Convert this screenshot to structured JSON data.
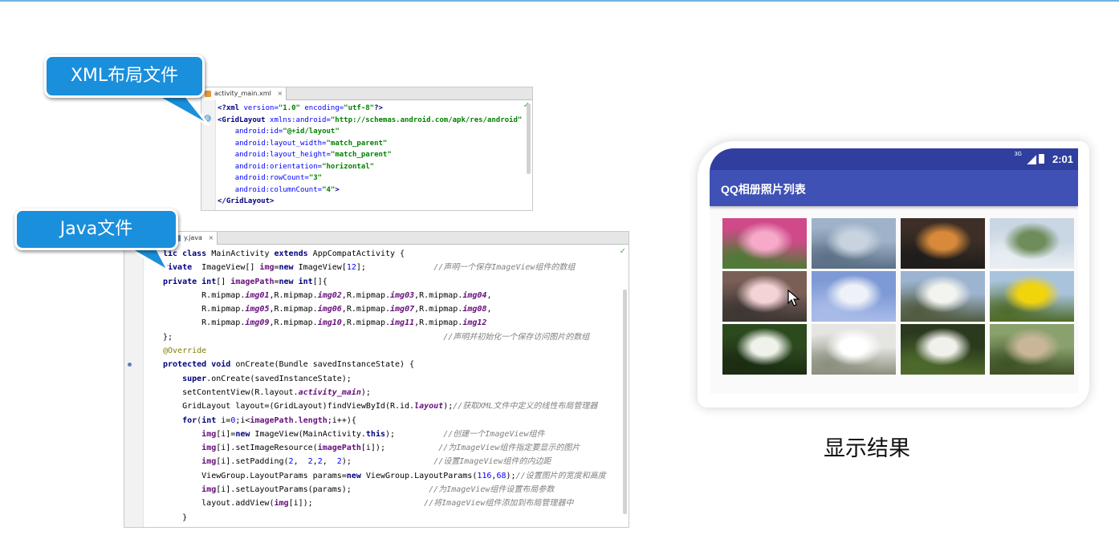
{
  "xml_editor": {
    "tab_label": "activity_main.xml",
    "tab_close": "×",
    "gutter_marker": "c",
    "lines": [
      [
        [
          "xt",
          "<?xml "
        ],
        [
          "xa",
          "version="
        ],
        [
          "xv",
          "\"1.0\" "
        ],
        [
          "xa",
          "encoding="
        ],
        [
          "xv",
          "\"utf-8\""
        ],
        [
          "xt",
          "?>"
        ]
      ],
      [
        [
          "xt",
          "<GridLayout "
        ],
        [
          "xa",
          "xmlns:android="
        ],
        [
          "xv",
          "\"http://schemas.android.com/apk/res/android\""
        ]
      ],
      [
        [
          "",
          "    "
        ],
        [
          "xa",
          "android:id="
        ],
        [
          "xv",
          "\"@+id/layout\""
        ]
      ],
      [
        [
          "",
          "    "
        ],
        [
          "xa",
          "android:layout_width="
        ],
        [
          "xv",
          "\"match_parent\""
        ]
      ],
      [
        [
          "",
          "    "
        ],
        [
          "xa",
          "android:layout_height="
        ],
        [
          "xv",
          "\"match_parent\""
        ]
      ],
      [
        [
          "",
          "    "
        ],
        [
          "xa",
          "android:orientation="
        ],
        [
          "xv",
          "\"horizontal\""
        ]
      ],
      [
        [
          "",
          "    "
        ],
        [
          "xa",
          "android:rowCount="
        ],
        [
          "xv",
          "\"3\""
        ]
      ],
      [
        [
          "",
          "    "
        ],
        [
          "xa",
          "android:columnCount="
        ],
        [
          "xv",
          "\"4\""
        ],
        [
          "xt",
          ">"
        ]
      ],
      [
        [
          "xt",
          "</GridLayout>"
        ]
      ]
    ]
  },
  "java_editor": {
    "tab_label": "y.java",
    "tab_close": "×",
    "lines": [
      [
        [
          "kw",
          "lic class "
        ],
        [
          "",
          "MainActivity "
        ],
        [
          "kw",
          "extends "
        ],
        [
          "",
          "AppCompatActivity {"
        ]
      ],
      [
        [
          "kw",
          "rivate  "
        ],
        [
          "",
          "ImageView[] "
        ],
        [
          "fd",
          "img"
        ],
        [
          "",
          "="
        ],
        [
          "kw",
          "new "
        ],
        [
          "",
          "ImageView["
        ],
        [
          "nm",
          "12"
        ],
        [
          "",
          "];              "
        ],
        [
          "cm",
          "//声明一个保存ImageView组件的数组"
        ]
      ],
      [
        [
          "kw",
          "private int"
        ],
        [
          "",
          "[] "
        ],
        [
          "fd",
          "imagePath"
        ],
        [
          "",
          "="
        ],
        [
          "kw",
          "new int"
        ],
        [
          "",
          "[]{"
        ]
      ],
      [
        [
          "",
          "        R.mipmap."
        ],
        [
          "fdi",
          "img01"
        ],
        [
          "",
          ",R.mipmap."
        ],
        [
          "fdi",
          "img02"
        ],
        [
          "",
          ",R.mipmap."
        ],
        [
          "fdi",
          "img03"
        ],
        [
          "",
          ",R.mipmap."
        ],
        [
          "fdi",
          "img04"
        ],
        [
          "",
          ","
        ]
      ],
      [
        [
          "",
          "        R.mipmap."
        ],
        [
          "fdi",
          "img05"
        ],
        [
          "",
          ",R.mipmap."
        ],
        [
          "fdi",
          "img06"
        ],
        [
          "",
          ",R.mipmap."
        ],
        [
          "fdi",
          "img07"
        ],
        [
          "",
          ",R.mipmap."
        ],
        [
          "fdi",
          "img08"
        ],
        [
          "",
          ","
        ]
      ],
      [
        [
          "",
          "        R.mipmap."
        ],
        [
          "fdi",
          "img09"
        ],
        [
          "",
          ",R.mipmap."
        ],
        [
          "fdi",
          "img10"
        ],
        [
          "",
          ",R.mipmap."
        ],
        [
          "fdi",
          "img11"
        ],
        [
          "",
          ",R.mipmap."
        ],
        [
          "fdi",
          "img12"
        ]
      ],
      [
        [
          "",
          "};                                                        "
        ],
        [
          "cm",
          "//声明并初始化一个保存访问图片的数组"
        ]
      ],
      [
        [
          "an",
          "@Override"
        ]
      ],
      [
        [
          "kw",
          "protected void "
        ],
        [
          "",
          "onCreate(Bundle savedInstanceState) {"
        ]
      ],
      [
        [
          "",
          "    "
        ],
        [
          "kw",
          "super"
        ],
        [
          "",
          ".onCreate(savedInstanceState);"
        ]
      ],
      [
        [
          "",
          "    setContentView(R.layout."
        ],
        [
          "fdi",
          "activity_main"
        ],
        [
          "",
          ");"
        ]
      ],
      [
        [
          "",
          "    GridLayout layout=(GridLayout)findViewById(R.id."
        ],
        [
          "fdi",
          "layout"
        ],
        [
          "",
          ");"
        ],
        [
          "cm",
          "//获取XML文件中定义的线性布局管理器"
        ]
      ],
      [
        [
          "",
          "    "
        ],
        [
          "kw",
          "for"
        ],
        [
          "",
          "("
        ],
        [
          "kw",
          "int "
        ],
        [
          "",
          "i="
        ],
        [
          "nm",
          "0"
        ],
        [
          "",
          ";i<"
        ],
        [
          "fd",
          "imagePath"
        ],
        [
          "",
          "."
        ],
        [
          "fd",
          "length"
        ],
        [
          "",
          ";i++){"
        ]
      ],
      [
        [
          "",
          "        "
        ],
        [
          "fd",
          "img"
        ],
        [
          "",
          "[i]="
        ],
        [
          "kw",
          "new "
        ],
        [
          "",
          "ImageView(MainActivity."
        ],
        [
          "kw",
          "this"
        ],
        [
          "",
          ");          "
        ],
        [
          "cm",
          "//创建一个ImageView组件"
        ]
      ],
      [
        [
          "",
          "        "
        ],
        [
          "fd",
          "img"
        ],
        [
          "",
          "[i].setImageResource("
        ],
        [
          "fd",
          "imagePath"
        ],
        [
          "",
          "[i]);           "
        ],
        [
          "cm",
          "//为ImageView组件指定要显示的图片"
        ]
      ],
      [
        [
          "",
          "        "
        ],
        [
          "fd",
          "img"
        ],
        [
          "",
          "[i].setPadding("
        ],
        [
          "nm",
          "2"
        ],
        [
          "",
          ",  "
        ],
        [
          "nm",
          "2"
        ],
        [
          "",
          ","
        ],
        [
          "nm",
          "2"
        ],
        [
          "",
          ",  "
        ],
        [
          "nm",
          "2"
        ],
        [
          "",
          ");                 "
        ],
        [
          "cm",
          "//设置ImageView组件的内边距"
        ]
      ],
      [
        [
          "",
          "        ViewGroup.LayoutParams params="
        ],
        [
          "kw",
          "new "
        ],
        [
          "",
          "ViewGroup.LayoutParams("
        ],
        [
          "nm",
          "116"
        ],
        [
          "",
          ","
        ],
        [
          "nm",
          "68"
        ],
        [
          "",
          ");"
        ],
        [
          "cm",
          "//设置图片的宽度和高度"
        ]
      ],
      [
        [
          "",
          "        "
        ],
        [
          "fd",
          "img"
        ],
        [
          "",
          "[i].setLayoutParams(params);                "
        ],
        [
          "cm",
          "//为ImageView组件设置布局参数"
        ]
      ],
      [
        [
          "",
          "        layout.addView("
        ],
        [
          "fd",
          "img"
        ],
        [
          "",
          "[i]);                       "
        ],
        [
          "cm",
          "//将ImageView组件添加到布局管理器中"
        ]
      ],
      [
        [
          "",
          "    }"
        ]
      ]
    ]
  },
  "callouts": {
    "xml": "XML布局文件",
    "java": "Java文件"
  },
  "phone": {
    "status_net": "3G",
    "status_time": "2:01",
    "toolbar_title": "QQ相册照片列表",
    "photo_grid": {
      "rows": 3,
      "columns": 4,
      "photos": [
        {
          "name": "pink-peony",
          "colors": [
            "#d04a8a",
            "#f6a9c9",
            "#4e7a35"
          ]
        },
        {
          "name": "lake-with-boat",
          "colors": [
            "#9fb2c9",
            "#c8d3df",
            "#5b6f85"
          ]
        },
        {
          "name": "sunset-over-water",
          "colors": [
            "#3d2f27",
            "#d88a3a",
            "#1f1c1b"
          ]
        },
        {
          "name": "waterfront-trees",
          "colors": [
            "#c9d6e3",
            "#6f8c5b",
            "#e9eef3"
          ]
        },
        {
          "name": "cherry-blossom",
          "colors": [
            "#7a5f57",
            "#f4d3d6",
            "#3d3632"
          ]
        },
        {
          "name": "blue-sky-clouds",
          "colors": [
            "#7e9ad6",
            "#eef1f8",
            "#a9bce8"
          ]
        },
        {
          "name": "white-pear-blossoms",
          "colors": [
            "#9db4d0",
            "#f3f3ef",
            "#505a3e"
          ]
        },
        {
          "name": "yellow-dandelion",
          "colors": [
            "#a9c3dc",
            "#f2d40d",
            "#4f6b2a"
          ]
        },
        {
          "name": "white-blossoms-leaves",
          "colors": [
            "#2d4a1f",
            "#eef2ea",
            "#1b2c12"
          ]
        },
        {
          "name": "white-flowers-closeup",
          "colors": [
            "#e5e5e2",
            "#ffffff",
            "#8a8f7d"
          ]
        },
        {
          "name": "white-blossoms-dark",
          "colors": [
            "#2b3a1e",
            "#f1f1ec",
            "#4e6a2c"
          ]
        },
        {
          "name": "tree-lined-path",
          "colors": [
            "#8ba16d",
            "#c9b699",
            "#3e5226"
          ]
        }
      ]
    }
  },
  "caption": "显示结果"
}
